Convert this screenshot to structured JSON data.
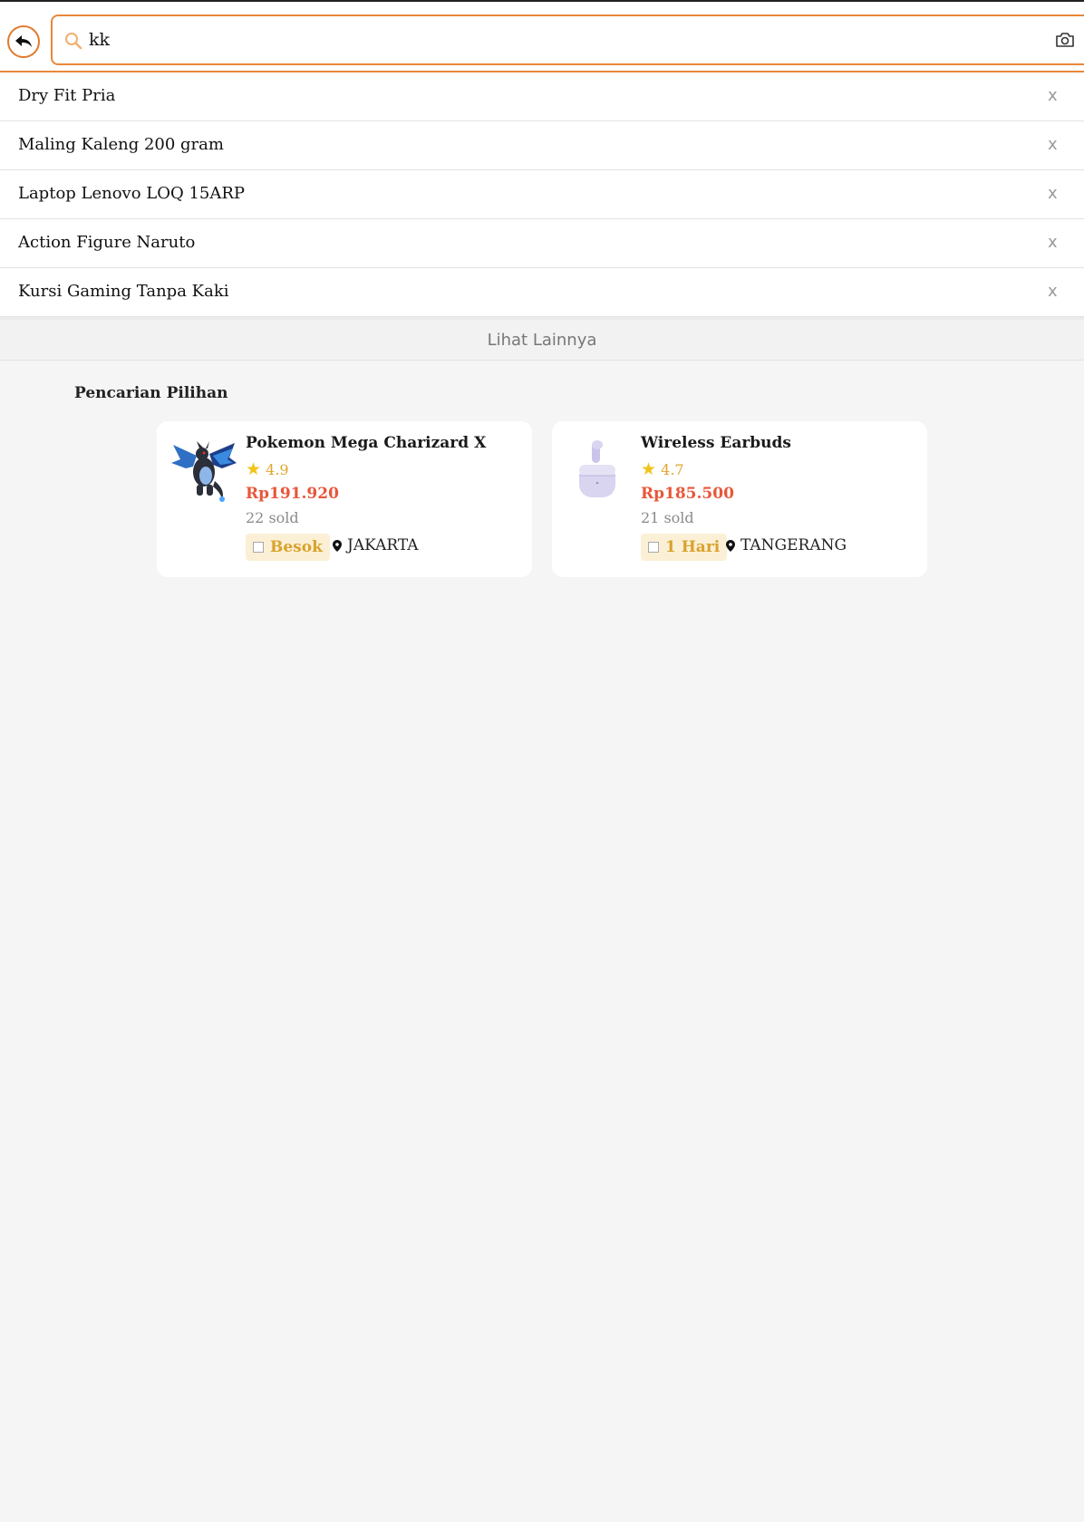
{
  "search": {
    "query": "kk"
  },
  "history": [
    {
      "label": "Dry Fit Pria",
      "close": "x"
    },
    {
      "label": "Maling Kaleng 200 gram",
      "close": "x"
    },
    {
      "label": "Laptop Lenovo LOQ 15ARP",
      "close": "x"
    },
    {
      "label": "Action Figure Naruto",
      "close": "x"
    },
    {
      "label": "Kursi Gaming Tanpa Kaki",
      "close": "x"
    }
  ],
  "more_label": "Lihat Lainnya",
  "section_title": "Pencarian Pilihan",
  "products": [
    {
      "name": "Pokemon Mega Charizard X",
      "rating": "4.9",
      "price": "Rp191.920",
      "sold": "22 sold",
      "delivery": "Besok",
      "location": "JAKARTA",
      "image_icon": "charizard-figure-icon"
    },
    {
      "name": "Wireless Earbuds",
      "rating": "4.7",
      "price": "Rp185.500",
      "sold": "21 sold",
      "delivery": "1 Hari",
      "location": "TANGERANG",
      "image_icon": "earbuds-icon"
    }
  ],
  "colors": {
    "accent": "#e8883a",
    "price": "#e8573a",
    "rating": "#e2a52a",
    "badge_bg": "#fbf0d6"
  }
}
